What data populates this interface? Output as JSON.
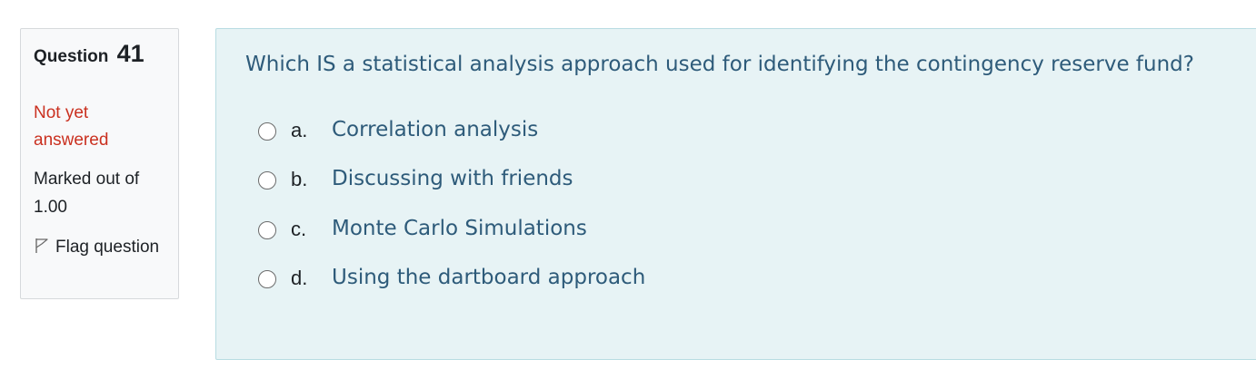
{
  "info": {
    "question_word": "Question",
    "question_number": "41",
    "state": "Not yet answered",
    "grade": "Marked out of 1.00",
    "flag_label": "Flag question",
    "flag_icon": "flag-outline-icon"
  },
  "question": {
    "text": "Which IS a statistical analysis approach used for identifying the contingency reserve fund?",
    "answers": [
      {
        "letter": "a.",
        "text": "Correlation analysis"
      },
      {
        "letter": "b.",
        "text": "Discussing with friends"
      },
      {
        "letter": "c.",
        "text": "Monte Carlo Simulations"
      },
      {
        "letter": "d.",
        "text": "Using the dartboard approach"
      }
    ]
  },
  "colors": {
    "state": "#ca3120",
    "question_text": "#2e5b7a",
    "formulation_bg": "#e7f3f5",
    "info_bg": "#f8f9fa"
  }
}
